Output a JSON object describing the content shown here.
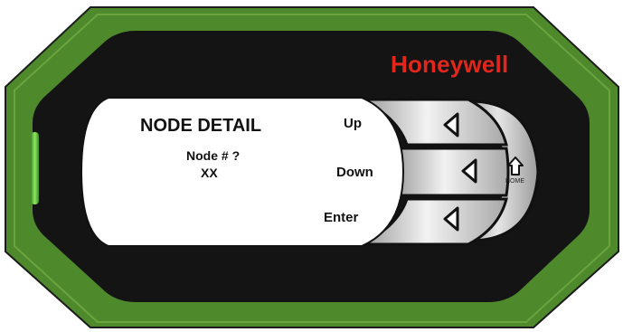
{
  "brand": {
    "name": "Honeywell",
    "color": "#e2261c"
  },
  "display": {
    "title": "NODE  DETAIL",
    "prompt": "Node # ?",
    "value": "XX"
  },
  "keys": {
    "up_label": "Up",
    "down_label": "Down",
    "enter_label": "Enter",
    "home_label": "HOME",
    "up_icon": "left-arrow-icon",
    "down_icon": "left-arrow-icon",
    "enter_icon": "left-arrow-icon",
    "home_icon": "home-arrow-icon"
  },
  "colors": {
    "bezel_green": "#4e8a2c",
    "face_black": "#141414",
    "led_green": "#6ed14a",
    "lcd_background": "#ffffff"
  }
}
